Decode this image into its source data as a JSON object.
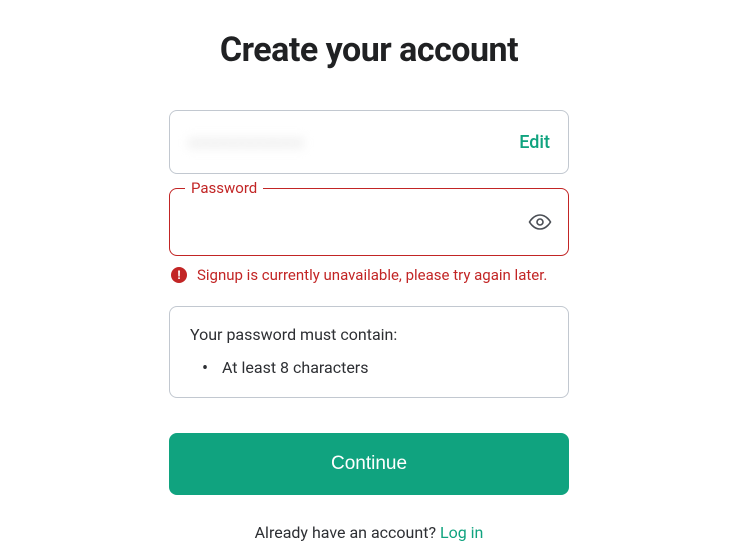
{
  "title": "Create your account",
  "email": {
    "value": "xxxxxxxxxxxxx",
    "edit_label": "Edit"
  },
  "password": {
    "label": "Password",
    "value": ""
  },
  "error": {
    "message": "Signup is currently unavailable, please try again later."
  },
  "requirements": {
    "title": "Your password must contain:",
    "items": [
      "At least 8 characters"
    ]
  },
  "continue_label": "Continue",
  "footer": {
    "prompt": "Already have an account?",
    "login_label": "Log in"
  },
  "colors": {
    "accent": "#10a37f",
    "error": "#c22525",
    "border": "#c2c8d0",
    "text": "#202123"
  }
}
